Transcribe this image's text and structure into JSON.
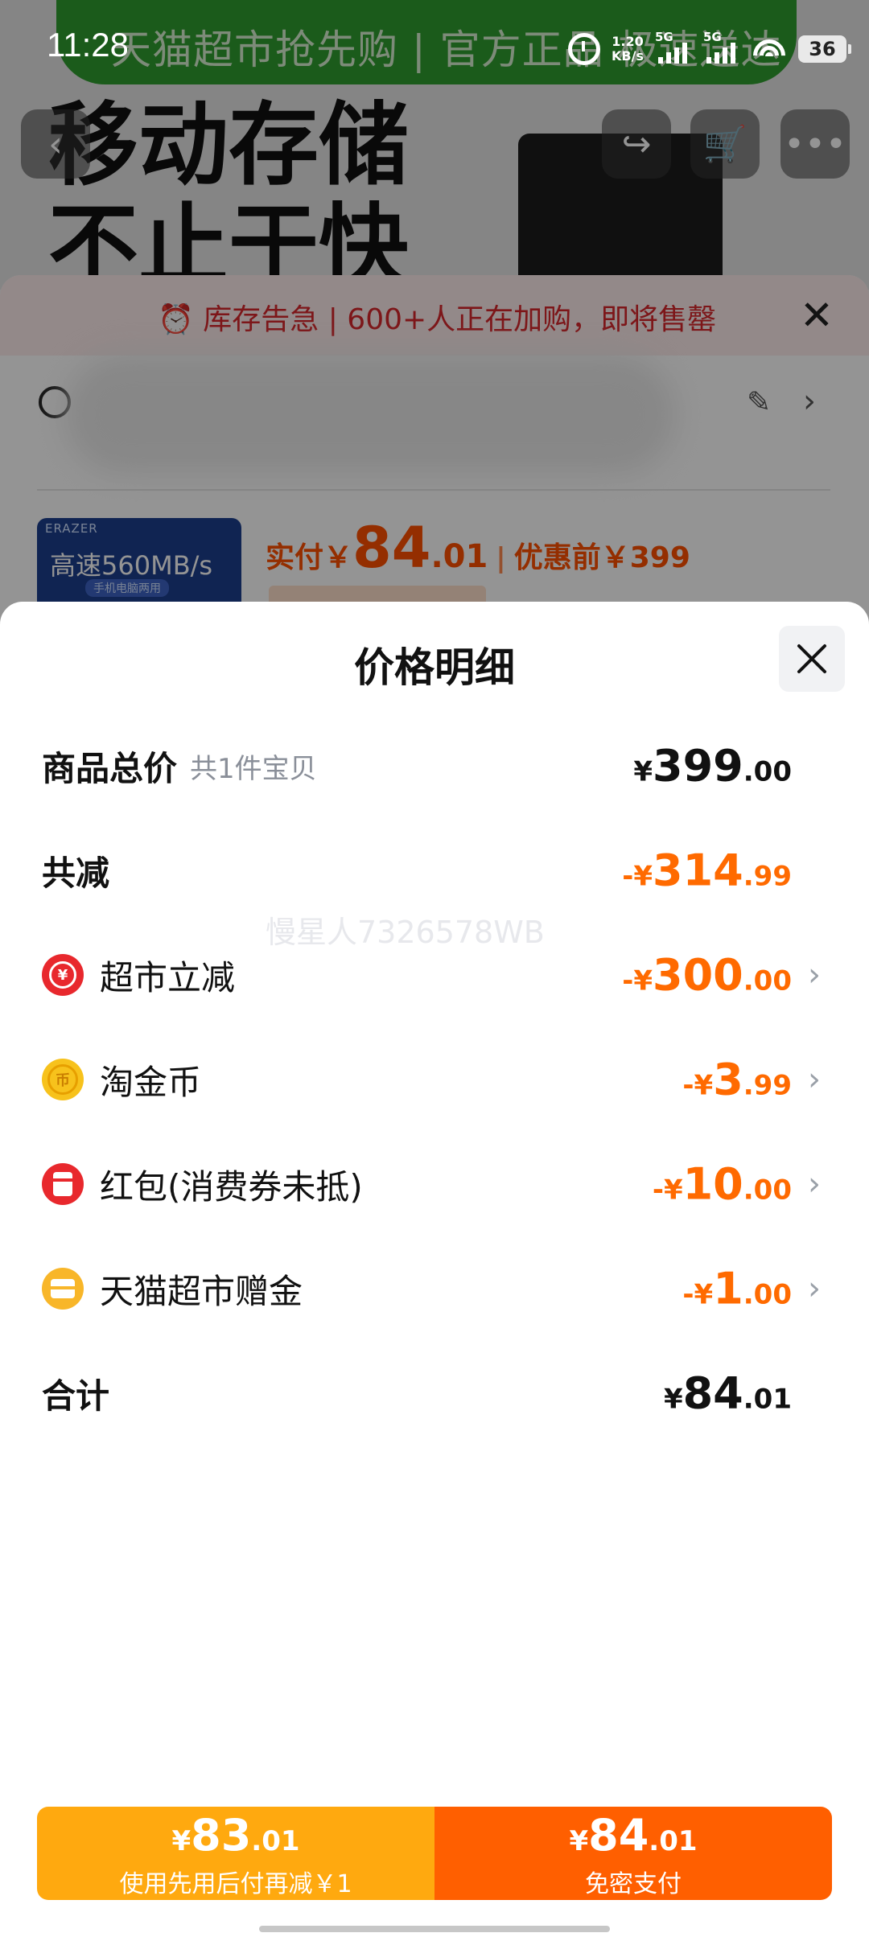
{
  "status_bar": {
    "time": "11:28",
    "net_speed_value": "1.20",
    "net_speed_unit": "KB/s",
    "sim1_label": "5G",
    "sim2_label": "5G",
    "battery": "36"
  },
  "background": {
    "banner_text": "天猫超市抢先购 | 官方正品 极速送达",
    "hero_title_line1": "移动存储",
    "hero_title_line2": "不止于快",
    "stock_alert": "库存告急 | 600+人正在加购，即将售罄",
    "product_thumb_brand": "ERAZER",
    "product_thumb_title": "高速560MB/s",
    "product_thumb_tag": "手机电脑两用",
    "pay_label": "实付￥",
    "pay_int": "84",
    "pay_dec": ".01",
    "pre_discount": "优惠前￥399"
  },
  "sheet": {
    "title": "价格明细",
    "watermark": "慢星人7326578WB"
  },
  "rows": [
    {
      "label": "商品总价",
      "sub": "共1件宝贝",
      "sign": "¥",
      "int": "399",
      "dec": ".00"
    },
    {
      "label": "共减",
      "sign": "-¥",
      "int": "314",
      "dec": ".99"
    },
    {
      "label": "超市立减",
      "sign": "-¥",
      "int": "300",
      "dec": ".00"
    },
    {
      "label": "淘金币",
      "sign": "-¥",
      "int": "3",
      "dec": ".99"
    },
    {
      "label": "红包(消费券未抵)",
      "sign": "-¥",
      "int": "10",
      "dec": ".00"
    },
    {
      "label": "天猫超市赠金",
      "sign": "-¥",
      "int": "1",
      "dec": ".00"
    },
    {
      "label": "合计",
      "sign": "¥",
      "int": "84",
      "dec": ".01"
    }
  ],
  "actions": {
    "paylater": {
      "sign": "¥",
      "int": "83",
      "dec": ".01",
      "label": "使用先用后付再减￥1"
    },
    "pay": {
      "sign": "¥",
      "int": "84",
      "dec": ".01",
      "label": "免密支付"
    }
  },
  "colors": {
    "discount_orange": "#ff6a00",
    "paylater_button": "#ffa90f",
    "pay_button": "#ff5f00"
  }
}
